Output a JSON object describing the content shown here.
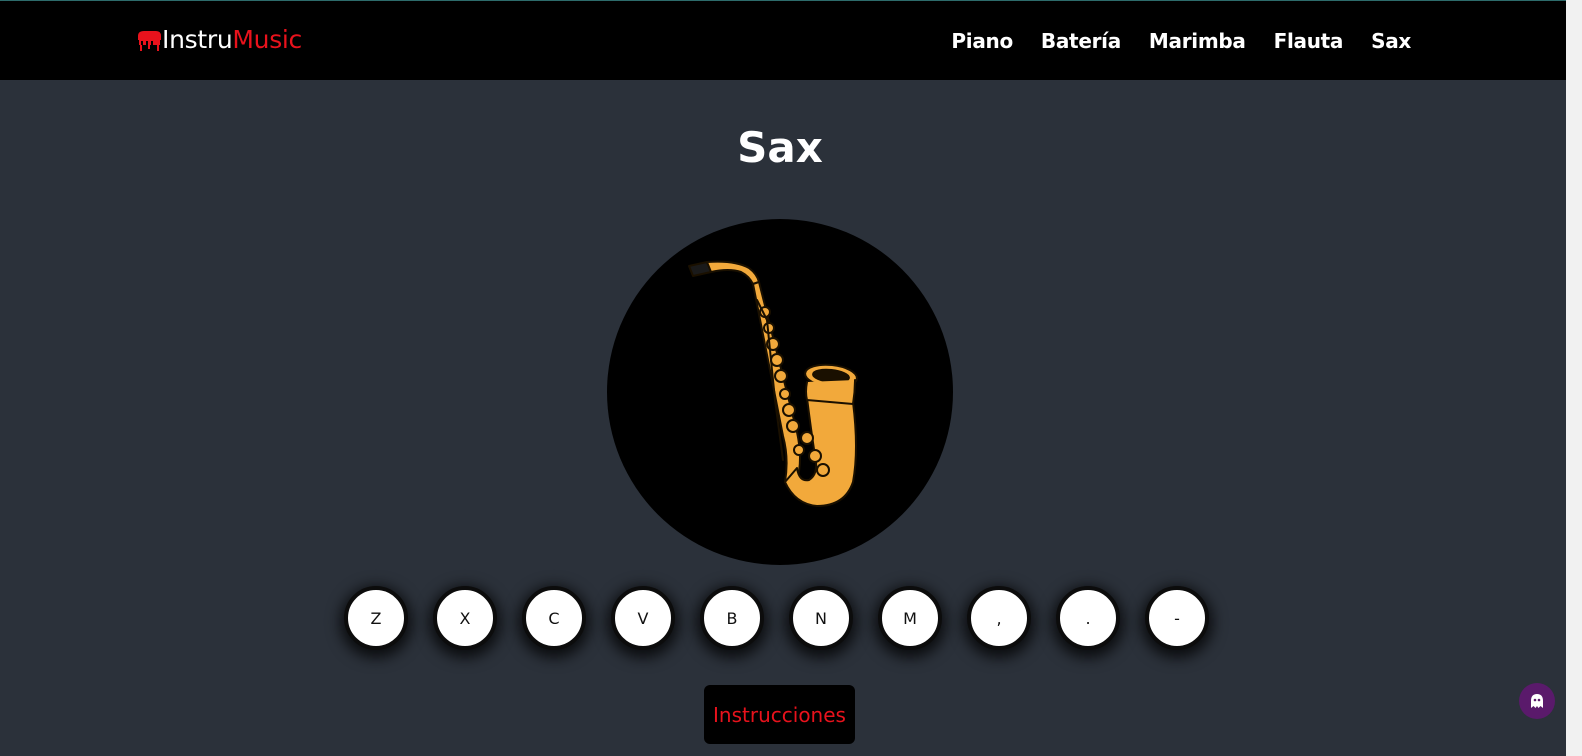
{
  "header": {
    "logo_text_a": "Instru",
    "logo_text_b": "Music",
    "nav": [
      {
        "label": "Piano"
      },
      {
        "label": "Batería"
      },
      {
        "label": "Marimba"
      },
      {
        "label": "Flauta"
      },
      {
        "label": "Sax"
      }
    ]
  },
  "main": {
    "title": "Sax",
    "instrument_icon": "saxophone-icon",
    "keys": [
      {
        "label": "Z"
      },
      {
        "label": "X"
      },
      {
        "label": "C"
      },
      {
        "label": "V"
      },
      {
        "label": "B"
      },
      {
        "label": "N"
      },
      {
        "label": "M"
      },
      {
        "label": ","
      },
      {
        "label": "."
      },
      {
        "label": "-"
      }
    ],
    "instructions_label": "Instrucciones"
  },
  "colors": {
    "background": "#2b313a",
    "navbar": "#000000",
    "accent_red": "#e8121c",
    "sax_gold": "#f2a93b",
    "badge_purple": "#5a1a6b"
  }
}
